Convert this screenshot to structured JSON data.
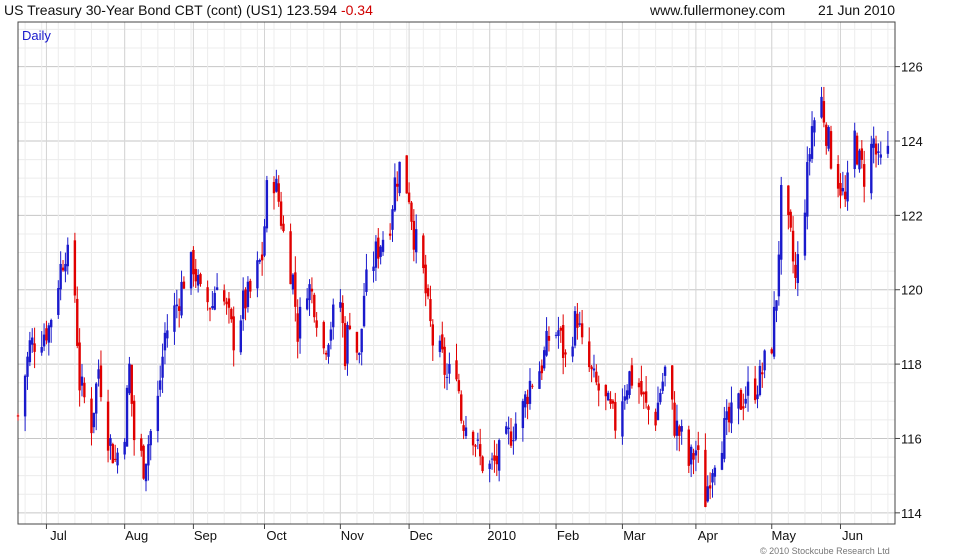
{
  "header": {
    "instrument": "US Treasury 30-Year  Bond CBT (cont) (US1)",
    "last": "123.594",
    "change": "-0.34",
    "site": "www.fullermoney.com",
    "date": "21 Jun 2010"
  },
  "frequency_label": "Daily",
  "copyright": "© 2010 Stockcube Research Ltd",
  "colors": {
    "up": "#1a1acc",
    "down": "#e00000",
    "grid": "#d8d8d8",
    "axis": "#444444"
  },
  "chart_data": {
    "type": "candlestick",
    "title": "US Treasury 30-Year  Bond CBT (cont) (US1)",
    "ylim": [
      113.7,
      127.2
    ],
    "yticks": [
      114,
      116,
      118,
      120,
      122,
      124,
      126
    ],
    "ytick_labels": [
      "114",
      "116",
      "118",
      "120",
      "122",
      "124",
      "126"
    ],
    "xlim": [
      "2009-06-19",
      "2010-06-24"
    ],
    "xticks": [
      {
        "date": "2009-07-01",
        "label": "Jul"
      },
      {
        "date": "2009-08-03",
        "label": "Aug"
      },
      {
        "date": "2009-09-01",
        "label": "Sep"
      },
      {
        "date": "2009-10-01",
        "label": "Oct"
      },
      {
        "date": "2009-11-02",
        "label": "Nov"
      },
      {
        "date": "2009-12-01",
        "label": "Dec"
      },
      {
        "date": "2010-01-04",
        "label": "2010"
      },
      {
        "date": "2010-02-01",
        "label": "Feb"
      },
      {
        "date": "2010-03-01",
        "label": "Mar"
      },
      {
        "date": "2010-04-01",
        "label": "Apr"
      },
      {
        "date": "2010-05-03",
        "label": "May"
      },
      {
        "date": "2010-06-01",
        "label": "Jun"
      }
    ],
    "grid": true,
    "y_axis_side": "right",
    "close_path": [
      [
        "2009-06-19",
        116.6
      ],
      [
        "2009-06-24",
        118.5
      ],
      [
        "2009-06-29",
        118.8
      ],
      [
        "2009-07-02",
        119.0
      ],
      [
        "2009-07-07",
        120.6
      ],
      [
        "2009-07-09",
        121.1
      ],
      [
        "2009-07-13",
        119.9
      ],
      [
        "2009-07-15",
        117.5
      ],
      [
        "2009-07-20",
        116.4
      ],
      [
        "2009-07-23",
        117.9
      ],
      [
        "2009-07-27",
        116.1
      ],
      [
        "2009-07-30",
        115.4
      ],
      [
        "2009-08-03",
        116.3
      ],
      [
        "2009-08-05",
        117.9
      ],
      [
        "2009-08-07",
        116.0
      ],
      [
        "2009-08-11",
        115.3
      ],
      [
        "2009-08-13",
        115.9
      ],
      [
        "2009-08-17",
        117.0
      ],
      [
        "2009-08-20",
        118.8
      ],
      [
        "2009-08-25",
        119.6
      ],
      [
        "2009-08-28",
        120.3
      ],
      [
        "2009-09-01",
        120.7
      ],
      [
        "2009-09-04",
        119.8
      ],
      [
        "2009-09-09",
        119.6
      ],
      [
        "2009-09-11",
        120.4
      ],
      [
        "2009-09-15",
        119.4
      ],
      [
        "2009-09-18",
        118.7
      ],
      [
        "2009-09-22",
        119.6
      ],
      [
        "2009-09-25",
        119.9
      ],
      [
        "2009-09-30",
        120.9
      ],
      [
        "2009-10-02",
        122.6
      ],
      [
        "2009-10-05",
        123.0
      ],
      [
        "2009-10-07",
        122.4
      ],
      [
        "2009-10-09",
        121.5
      ],
      [
        "2009-10-13",
        120.3
      ],
      [
        "2009-10-15",
        118.9
      ],
      [
        "2009-10-19",
        120.2
      ],
      [
        "2009-10-22",
        119.7
      ],
      [
        "2009-10-26",
        118.4
      ],
      [
        "2009-10-29",
        119.1
      ],
      [
        "2009-11-02",
        119.7
      ],
      [
        "2009-11-04",
        118.3
      ],
      [
        "2009-11-06",
        119.3
      ],
      [
        "2009-11-10",
        118.1
      ],
      [
        "2009-11-12",
        119.9
      ],
      [
        "2009-11-16",
        120.8
      ],
      [
        "2009-11-19",
        121.3
      ],
      [
        "2009-11-23",
        121.9
      ],
      [
        "2009-11-25",
        122.9
      ],
      [
        "2009-11-27",
        123.3
      ],
      [
        "2009-12-01",
        122.6
      ],
      [
        "2009-12-03",
        121.5
      ],
      [
        "2009-12-07",
        120.4
      ],
      [
        "2009-12-09",
        119.4
      ],
      [
        "2009-12-11",
        118.6
      ],
      [
        "2009-12-15",
        118.1
      ],
      [
        "2009-12-17",
        117.6
      ],
      [
        "2009-12-21",
        118.0
      ],
      [
        "2009-12-23",
        116.6
      ],
      [
        "2009-12-28",
        116.2
      ],
      [
        "2009-12-31",
        115.4
      ],
      [
        "2010-01-04",
        115.2
      ],
      [
        "2010-01-07",
        115.4
      ],
      [
        "2010-01-11",
        115.9
      ],
      [
        "2010-01-14",
        116.3
      ],
      [
        "2010-01-18",
        116.8
      ],
      [
        "2010-01-21",
        117.5
      ],
      [
        "2010-01-26",
        118.0
      ],
      [
        "2010-01-29",
        118.7
      ],
      [
        "2010-02-02",
        118.9
      ],
      [
        "2010-02-05",
        118.1
      ],
      [
        "2010-02-08",
        118.9
      ],
      [
        "2010-02-10",
        119.3
      ],
      [
        "2010-02-12",
        118.4
      ],
      [
        "2010-02-17",
        117.5
      ],
      [
        "2010-02-19",
        117.3
      ],
      [
        "2010-02-23",
        116.8
      ],
      [
        "2010-02-26",
        116.4
      ],
      [
        "2010-03-01",
        117.2
      ],
      [
        "2010-03-04",
        117.7
      ],
      [
        "2010-03-08",
        117.4
      ],
      [
        "2010-03-11",
        116.8
      ],
      [
        "2010-03-15",
        116.6
      ],
      [
        "2010-03-17",
        117.3
      ],
      [
        "2010-03-19",
        117.8
      ],
      [
        "2010-03-23",
        116.4
      ],
      [
        "2010-03-26",
        116.0
      ],
      [
        "2010-03-29",
        115.3
      ],
      [
        "2010-04-01",
        115.7
      ],
      [
        "2010-04-05",
        114.4
      ],
      [
        "2010-04-07",
        115.1
      ],
      [
        "2010-04-09",
        115.6
      ],
      [
        "2010-04-13",
        116.2
      ],
      [
        "2010-04-15",
        116.4
      ],
      [
        "2010-04-19",
        116.9
      ],
      [
        "2010-04-22",
        117.2
      ],
      [
        "2010-04-26",
        117.4
      ],
      [
        "2010-04-28",
        117.6
      ],
      [
        "2010-05-03",
        118.6
      ],
      [
        "2010-05-05",
        119.9
      ],
      [
        "2010-05-07",
        122.4
      ],
      [
        "2010-05-11",
        121.3
      ],
      [
        "2010-05-13",
        120.2
      ],
      [
        "2010-05-17",
        122.4
      ],
      [
        "2010-05-20",
        124.4
      ],
      [
        "2010-05-24",
        125.1
      ],
      [
        "2010-05-26",
        124.3
      ],
      [
        "2010-05-28",
        123.6
      ],
      [
        "2010-06-01",
        122.8
      ],
      [
        "2010-06-03",
        122.3
      ],
      [
        "2010-06-07",
        124.1
      ],
      [
        "2010-06-09",
        123.4
      ],
      [
        "2010-06-11",
        123.1
      ],
      [
        "2010-06-15",
        124.0
      ],
      [
        "2010-06-17",
        123.3
      ],
      [
        "2010-06-21",
        123.6
      ]
    ]
  }
}
